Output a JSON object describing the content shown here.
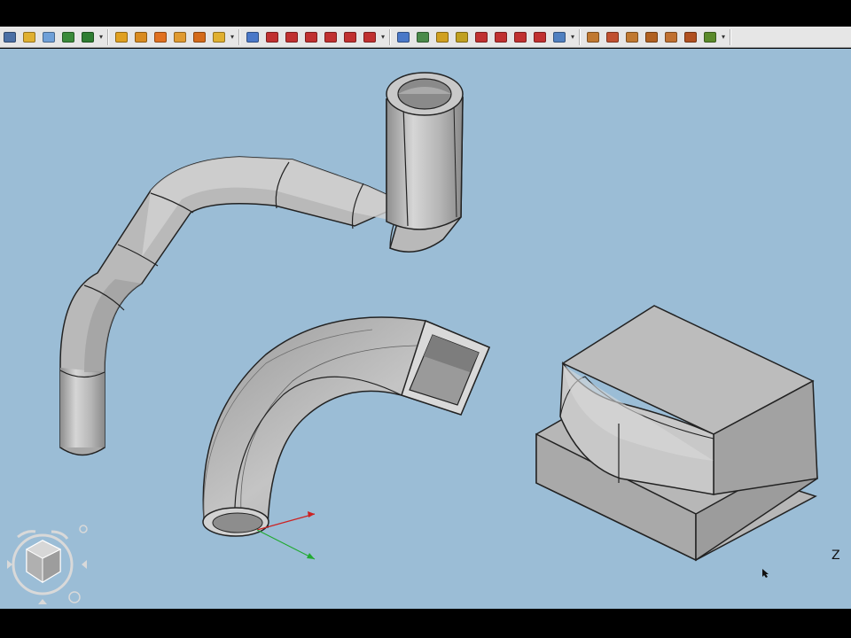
{
  "toolbar": {
    "groups": [
      {
        "name": "standard",
        "icons": [
          {
            "name": "whats-this-icon",
            "color": "#4a6fa5"
          },
          {
            "name": "workbench-icon",
            "color": "#e0b030"
          },
          {
            "name": "new-document-icon",
            "color": "#6fa0d8"
          },
          {
            "name": "refresh-icon",
            "color": "#3a8a3a"
          },
          {
            "name": "macro-icon",
            "color": "#2e7d32"
          }
        ]
      },
      {
        "name": "part-design-sketch",
        "icons": [
          {
            "name": "sketch-icon",
            "color": "#e0a020"
          },
          {
            "name": "sketch-edit-icon",
            "color": "#d98b20"
          },
          {
            "name": "sketch-validate-icon",
            "color": "#e07020"
          },
          {
            "name": "sketch-map-icon",
            "color": "#e09a30"
          },
          {
            "name": "sketch-run-icon",
            "color": "#d46a1a"
          },
          {
            "name": "sketch-merge-icon",
            "color": "#e0b030"
          }
        ]
      },
      {
        "name": "part-design-features",
        "icons": [
          {
            "name": "pad-icon",
            "color": "#4a78c8"
          },
          {
            "name": "pocket-icon",
            "color": "#c03030"
          },
          {
            "name": "revolution-icon",
            "color": "#c03030"
          },
          {
            "name": "groove-icon",
            "color": "#c03030"
          },
          {
            "name": "fillet-icon",
            "color": "#c03030"
          },
          {
            "name": "chamfer-run-icon",
            "color": "#c03030"
          },
          {
            "name": "draft-icon",
            "color": "#c03030"
          }
        ]
      },
      {
        "name": "part-design-transform",
        "icons": [
          {
            "name": "mirrored-icon",
            "color": "#4a78c8"
          },
          {
            "name": "linear-pattern-icon",
            "color": "#4a8a4a"
          },
          {
            "name": "polar-pattern-icon",
            "color": "#d0a020"
          },
          {
            "name": "scaled-icon",
            "color": "#c0a020"
          },
          {
            "name": "multi-transform-icon",
            "color": "#c03030"
          },
          {
            "name": "boolean-icon",
            "color": "#c03030"
          },
          {
            "name": "thickness-icon",
            "color": "#c03030"
          },
          {
            "name": "body-icon",
            "color": "#c03030"
          },
          {
            "name": "measure-icon",
            "color": "#5080c0"
          }
        ]
      },
      {
        "name": "sketcher",
        "icons": [
          {
            "name": "sketch-view-icon",
            "color": "#c07830"
          },
          {
            "name": "sketch-reorient-icon",
            "color": "#c05030"
          },
          {
            "name": "sketch-close-icon",
            "color": "#c07830"
          },
          {
            "name": "sketch-attach-icon",
            "color": "#b06020"
          },
          {
            "name": "sketch-mirror-icon",
            "color": "#c07030"
          },
          {
            "name": "sketch-merge-icon",
            "color": "#b05020"
          },
          {
            "name": "sketch-validate-check-icon",
            "color": "#5a8a2a"
          }
        ]
      }
    ]
  },
  "viewport": {
    "background": "#9bbdd6",
    "axis_label": "Z"
  },
  "colors": {
    "model_surface": "#b7b7b7",
    "model_light": "#d9d9d9",
    "model_dark": "#8f8f8f",
    "edge": "#111111",
    "axis_x": "#cc2222",
    "axis_y": "#22aa33"
  }
}
